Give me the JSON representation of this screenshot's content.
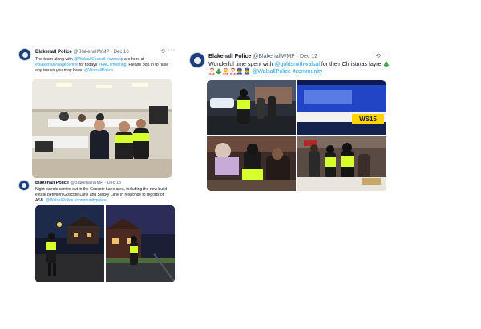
{
  "tweets": [
    {
      "author": "Blakenall Police",
      "handle": "@BlakenallWMP",
      "sep": " · ",
      "date": "Dec 16",
      "text": [
        {
          "t": "The team along with ",
          "link": false
        },
        {
          "t": "@WalsallCouncil",
          "link": true
        },
        {
          "t": " ",
          "link": false
        },
        {
          "t": "#ewnshp",
          "link": true
        },
        {
          "t": " are here at ",
          "link": false
        },
        {
          "t": "#Blakenallvillagecentre",
          "link": true
        },
        {
          "t": " for todays ",
          "link": false
        },
        {
          "t": "#PACTmeeting",
          "link": true
        },
        {
          "t": ". Please pop in to raise any issues you may have. ",
          "link": false
        },
        {
          "t": "@WalsallPolice",
          "link": true
        }
      ]
    },
    {
      "author": "Blakenall Police",
      "handle": "@BlakenallWMP",
      "sep": " · ",
      "date": "Dec 13",
      "text": [
        {
          "t": "Night patrols carried out in the Goscote Lane area, including the new build estate between Goscote Lane and Slacky Lane in response to reports of ASB. ",
          "link": false
        },
        {
          "t": "@WalsallPolice",
          "link": true
        },
        {
          "t": " ",
          "link": false
        },
        {
          "t": "#communitypolice",
          "link": true
        }
      ]
    },
    {
      "author": "Blakenall Police",
      "handle": "@BlakenallWMP",
      "sep": " · ",
      "date": "Dec 12",
      "text": [
        {
          "t": "Wonderful time spent with ",
          "link": false
        },
        {
          "t": "@goldsmithwalsal",
          "link": true
        },
        {
          "t": " for their Christmas fayre 🎄",
          "link": false
        }
      ],
      "emoji_line": "🎅🎄🤶🎅👮👮",
      "text2": [
        {
          "t": " ",
          "link": false
        },
        {
          "t": "@WalsallPolice",
          "link": true
        },
        {
          "t": " ",
          "link": false
        },
        {
          "t": "#community",
          "link": true
        }
      ],
      "van_marking": "WS15"
    }
  ],
  "more_label": "···",
  "colors": {
    "link": "#1d9bf0",
    "meta": "#536471",
    "police_yellow": "#d7ff2b",
    "police_blue": "#1c3fa8"
  }
}
